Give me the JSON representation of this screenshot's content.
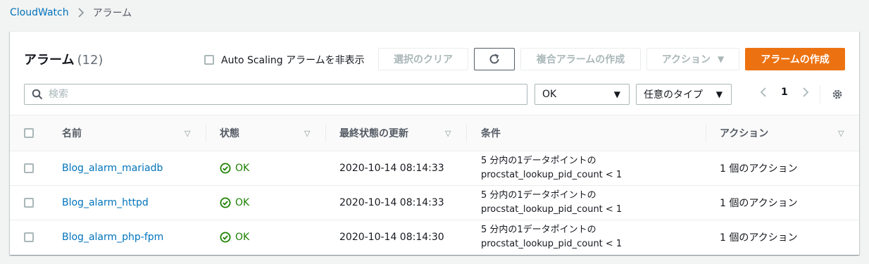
{
  "breadcrumb": {
    "root": "CloudWatch",
    "current": "アラーム"
  },
  "header": {
    "title": "アラーム",
    "count": "(12)"
  },
  "toolbar": {
    "hide_autoscaling_label": "Auto Scaling アラームを非表示",
    "clear_selection": "選択のクリア",
    "create_composite": "複合アラームの作成",
    "actions": "アクション",
    "create_alarm": "アラームの作成"
  },
  "filters": {
    "search_placeholder": "検索",
    "state_value": "OK",
    "type_value": "任意のタイプ"
  },
  "pagination": {
    "current_page": "1"
  },
  "table": {
    "columns": [
      "名前",
      "状態",
      "最終状態の更新",
      "条件",
      "アクション"
    ],
    "rows": [
      {
        "name": "Blog_alarm_mariadb",
        "state": "OK",
        "updated": "2020-10-14 08:14:33",
        "condition_line1": "5 分内の1データポイントの",
        "condition_line2": "procstat_lookup_pid_count < 1",
        "actions": "1 個のアクション"
      },
      {
        "name": "Blog_alarm_httpd",
        "state": "OK",
        "updated": "2020-10-14 08:14:33",
        "condition_line1": "5 分内の1データポイントの",
        "condition_line2": "procstat_lookup_pid_count < 1",
        "actions": "1 個のアクション"
      },
      {
        "name": "Blog_alarm_php-fpm",
        "state": "OK",
        "updated": "2020-10-14 08:14:30",
        "condition_line1": "5 分内の1データポイントの",
        "condition_line2": "procstat_lookup_pid_count < 1",
        "actions": "1 個のアクション"
      }
    ]
  },
  "icons": {
    "search": "search-icon",
    "refresh": "refresh-icon",
    "settings": "gear-icon",
    "ok": "check-circle-icon"
  },
  "colors": {
    "link": "#0073bb",
    "primary": "#ec7211",
    "ok": "#1d8102"
  }
}
